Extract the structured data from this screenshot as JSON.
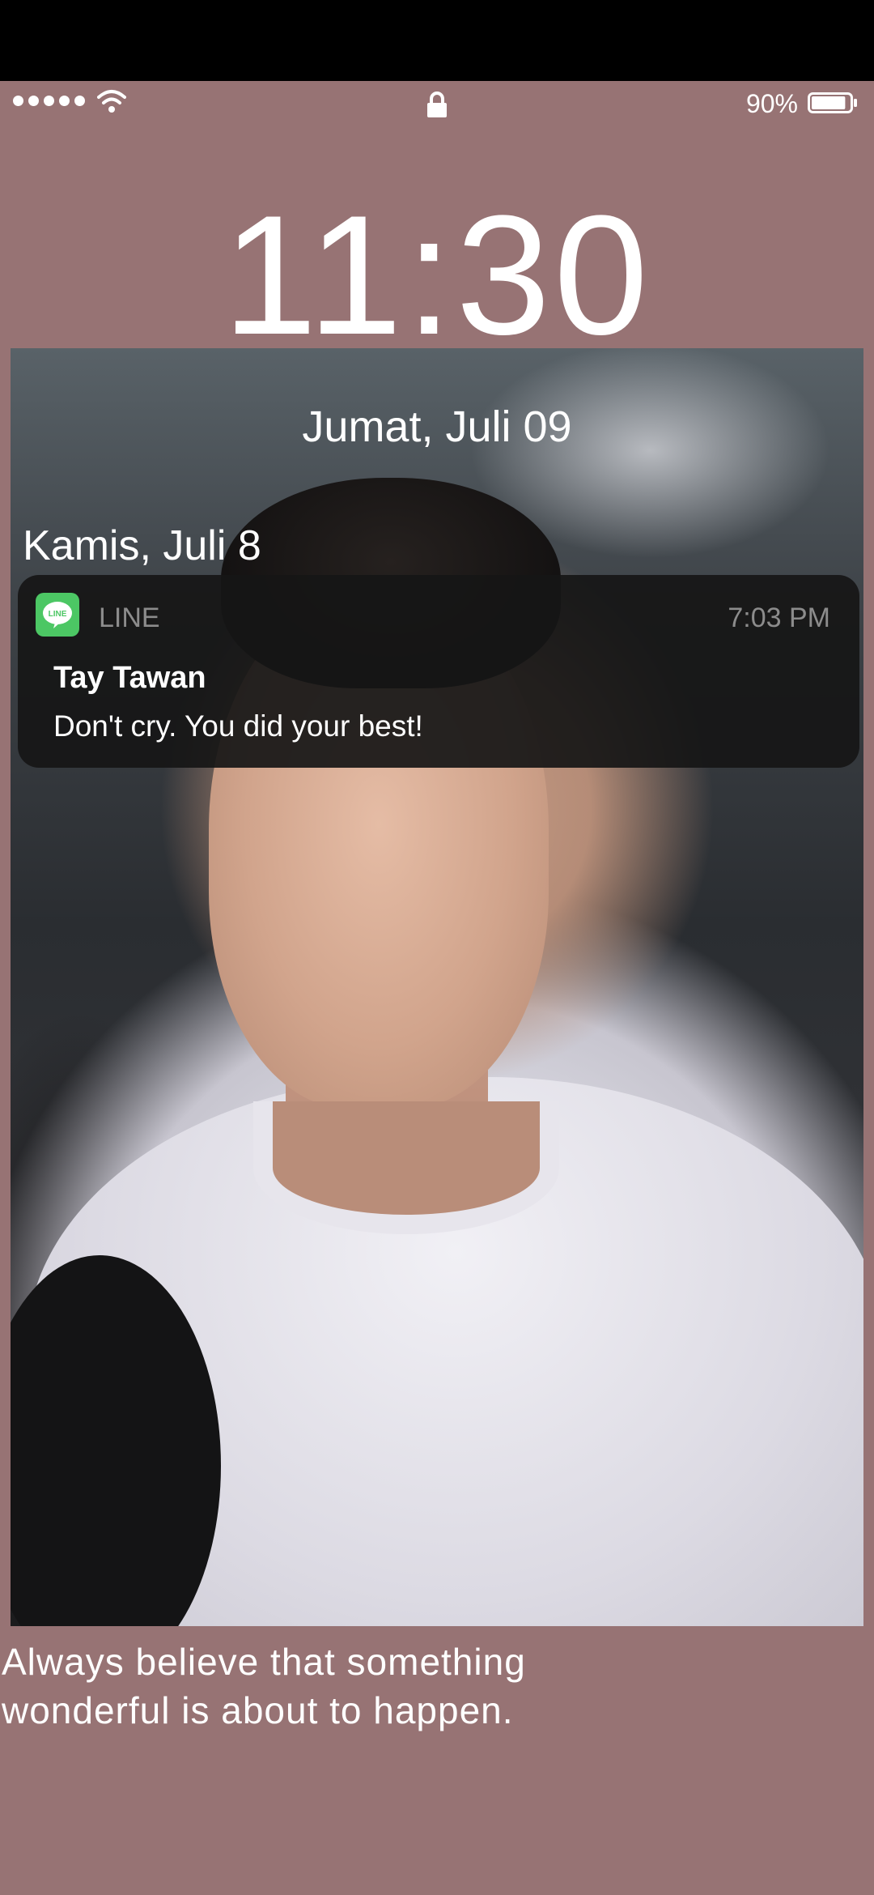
{
  "status_bar": {
    "signal_bars": 5,
    "battery_percent": "90%",
    "battery_level": 0.9,
    "lock_icon": "lock-icon"
  },
  "lock_screen": {
    "time": "11:30",
    "date_today": "Jumat, Juli 09",
    "date_previous": "Kamis, Juli 8"
  },
  "notification": {
    "app_icon": "line-app-icon",
    "app_name": "LINE",
    "time": "7:03 PM",
    "sender": "Tay Tawan",
    "message": "Don't cry. You did your best!"
  },
  "quote": {
    "line1": "Always believe that something",
    "line2": "wonderful is about to happen."
  },
  "colors": {
    "background": "#977374",
    "line_green": "#4cc764",
    "notification_bg": "#161616"
  }
}
